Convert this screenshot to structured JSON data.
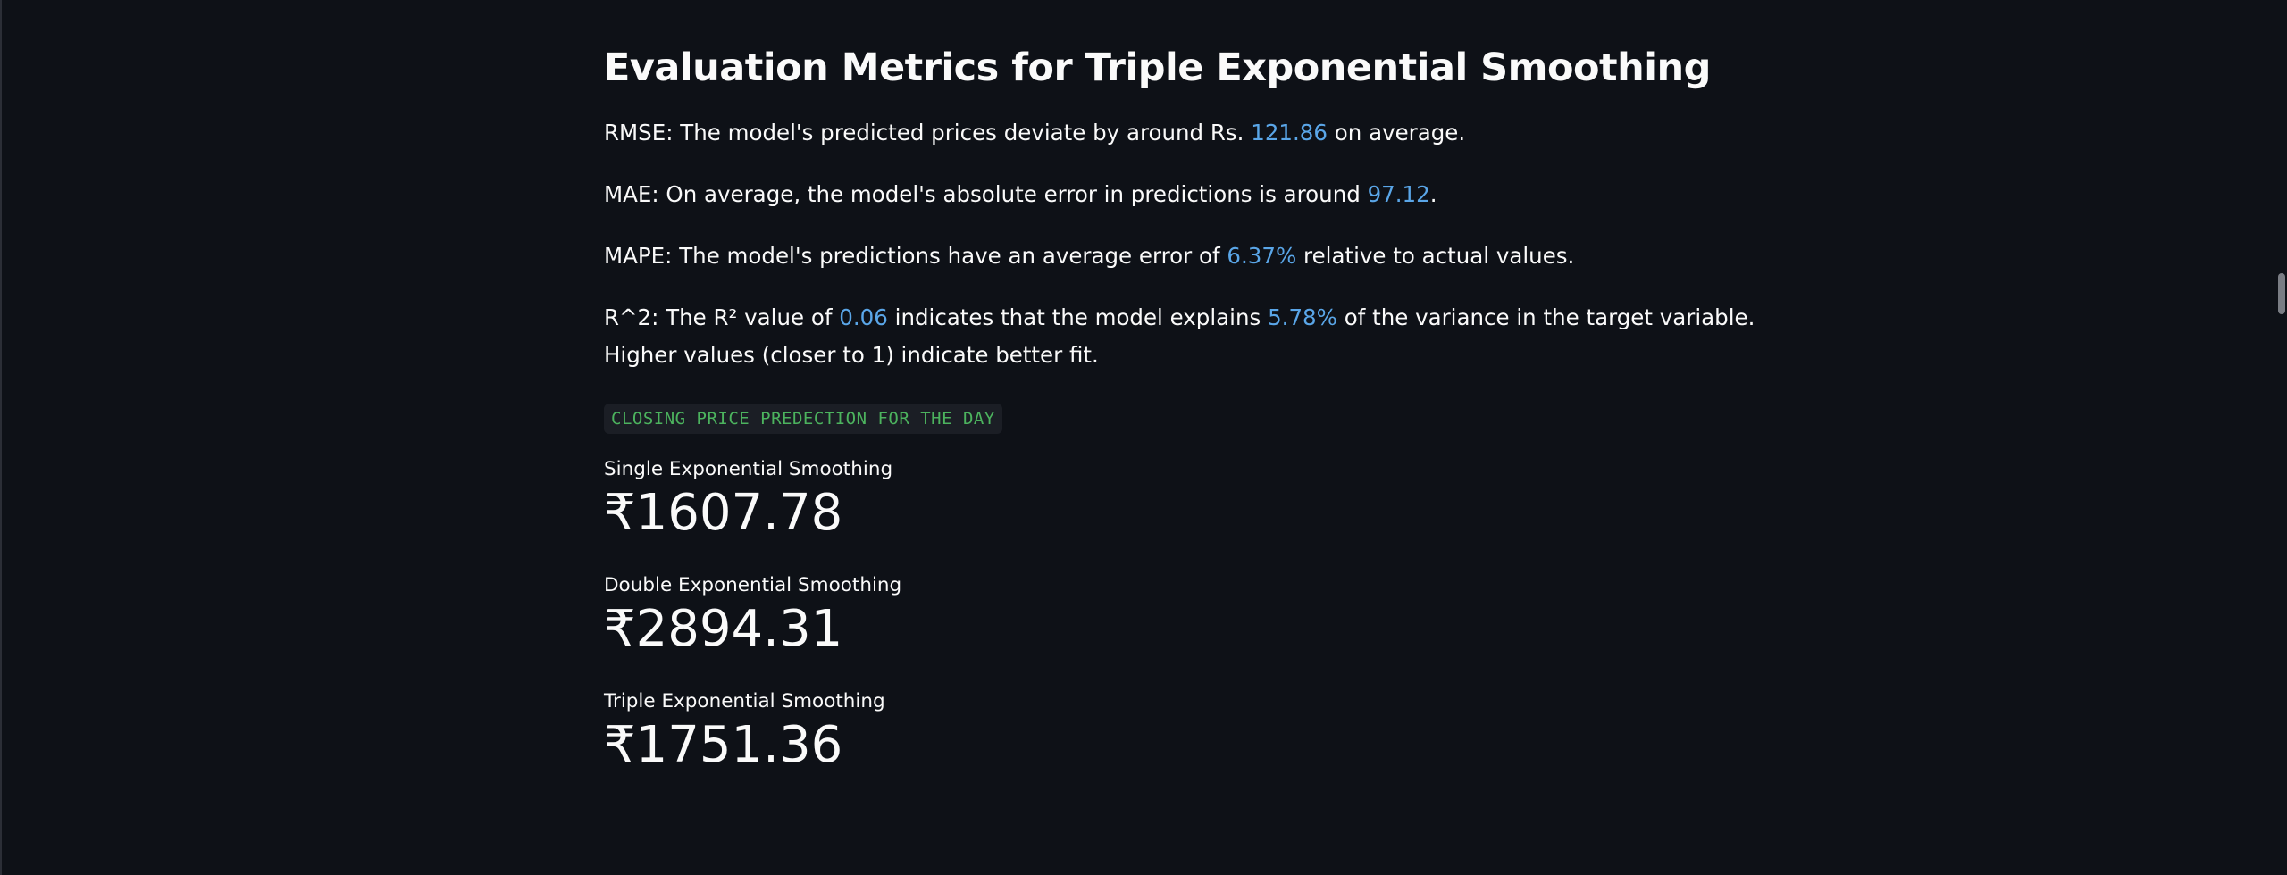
{
  "section": {
    "title": "Evaluation Metrics for Triple Exponential Smoothing"
  },
  "metrics": {
    "rmse": {
      "prefix": "RMSE: The model's predicted prices deviate by around Rs. ",
      "value": "121.86",
      "suffix": " on average."
    },
    "mae": {
      "prefix": "MAE: On average, the model's absolute error in predictions is around ",
      "value": "97.12",
      "suffix": "."
    },
    "mape": {
      "prefix": "MAPE: The model's predictions have an average error of ",
      "value": "6.37%",
      "suffix": " relative to actual values."
    },
    "r2": {
      "prefix": "R^2: The R² value of ",
      "value": "0.06",
      "middle": " indicates that the model explains ",
      "percent": "5.78%",
      "suffix": " of the variance in the target variable.",
      "line2": "Higher values (closer to 1) indicate better fit."
    }
  },
  "prediction": {
    "code_label": "CLOSING PRICE PREDECTION FOR THE DAY",
    "items": [
      {
        "label": "Single Exponential Smoothing",
        "value": "₹1607.78"
      },
      {
        "label": "Double Exponential Smoothing",
        "value": "₹2894.31"
      },
      {
        "label": "Triple Exponential Smoothing",
        "value": "₹1751.36"
      }
    ]
  },
  "colors": {
    "background": "#0e1117",
    "text": "#fafafa",
    "highlight": "#5aa6e8",
    "code_text": "#4cb35e",
    "code_bg": "#1b1e25"
  }
}
